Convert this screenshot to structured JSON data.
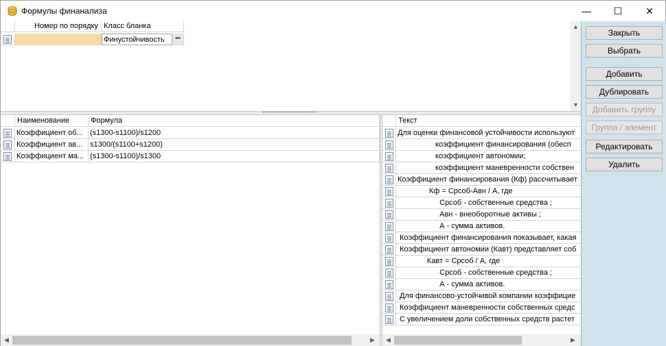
{
  "window": {
    "title": "Формулы финанализа",
    "minimize_glyph": "—",
    "maximize_glyph": "☐",
    "close_glyph": "✕"
  },
  "top_grid": {
    "columns": [
      "Номер по порядку",
      "Класс бланка"
    ],
    "rows": [
      {
        "number": "",
        "class": "Финустойчивость",
        "ellipsis": "•••"
      }
    ]
  },
  "left_grid": {
    "columns": [
      "Наименование",
      "Формула"
    ],
    "rows": [
      {
        "name": "Коэффициент об...",
        "formula": "(s1300-s1100)/s1200"
      },
      {
        "name": "Коэффициент ав...",
        "formula": "s1300/(s1100+s1200)"
      },
      {
        "name": "Коэффициент ма...",
        "formula": "(s1300-s1100)/s1300"
      }
    ]
  },
  "right_grid": {
    "columns": [
      "Текст"
    ],
    "rows": [
      "Для оценки финансовой устойчивости используют",
      "                  коэффициент финансирования (обесп",
      "                  коэффициент автономии;",
      "                  коэффициент маневренности собствен",
      "Коэффициент финансирования (Кф) рассчитывает",
      "               Кф = Срсоб-Авн / А, где",
      "                    Срсоб - собственные средства ;",
      "                    Авн - внеоборотные активы ;",
      "                    А - сумма активов.",
      " Коэффициент финансирования показывает, какая",
      " Коэффициент автономии (Кавт) представляет соб",
      "              Кавт = Срсоб / А, где",
      "                    Срсоб - собственные средства ;",
      "                    А - сумма активов.",
      " Для финансово-устойчивой компании коэффицие",
      " Коэффициент маневренности собственных средс",
      " С увеличением доли собственных средств растет"
    ]
  },
  "buttons": [
    {
      "label": "Закрыть",
      "enabled": true
    },
    {
      "label": "Выбрать",
      "enabled": true
    },
    {
      "label": "Добавить",
      "enabled": true
    },
    {
      "label": "Дублировать",
      "enabled": true
    },
    {
      "label": "Добавить группу",
      "enabled": false
    },
    {
      "label": "Группа / элемент",
      "enabled": false
    },
    {
      "label": "Редактировать",
      "enabled": true
    },
    {
      "label": "Удалить",
      "enabled": true
    }
  ],
  "colors": {
    "panel_bg": "#cfe3ec",
    "selected_cell": "#fbd9a3",
    "selected_border": "#e0a040"
  }
}
